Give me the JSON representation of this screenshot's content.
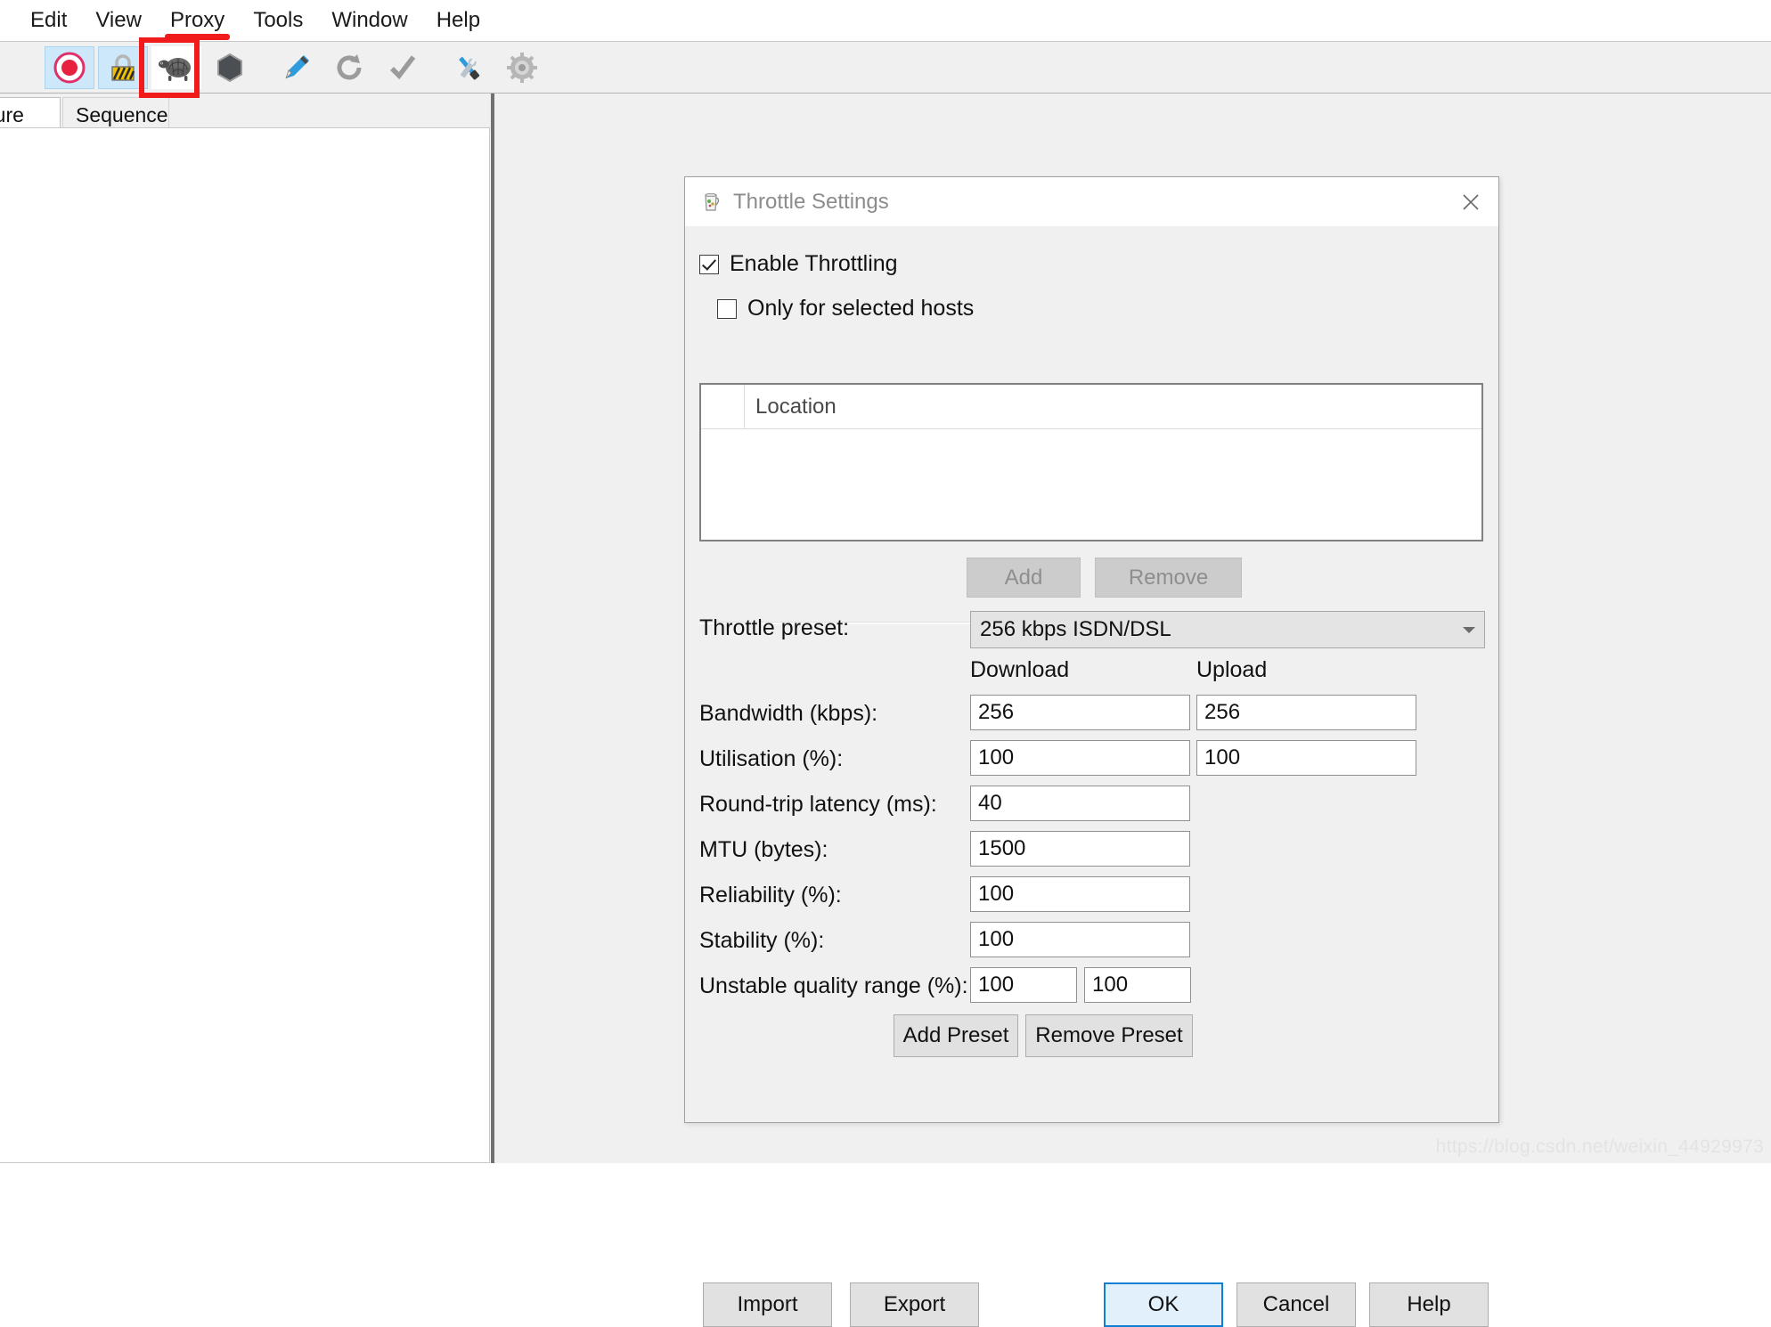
{
  "menubar": {
    "items": [
      {
        "label": "Edit",
        "underlined": false
      },
      {
        "label": "View",
        "underlined": false
      },
      {
        "label": "Proxy",
        "underlined": true
      },
      {
        "label": "Tools",
        "underlined": false
      },
      {
        "label": "Window",
        "underlined": false
      },
      {
        "label": "Help",
        "underlined": false
      }
    ]
  },
  "toolbar": {
    "icons": [
      {
        "name": "drag-handle-icon",
        "selected": false
      },
      {
        "name": "record-icon",
        "selected": true
      },
      {
        "name": "ssl-proxying-icon",
        "selected": true
      },
      {
        "name": "throttle-turtle-icon",
        "selected": false,
        "highlighted": true
      },
      {
        "name": "breakpoints-hexagon-icon",
        "selected": false
      },
      {
        "name": "compose-pen-icon",
        "selected": false
      },
      {
        "name": "repeat-refresh-icon",
        "selected": false
      },
      {
        "name": "validate-check-icon",
        "selected": false
      },
      {
        "name": "tools-icon",
        "selected": false
      },
      {
        "name": "settings-gear-icon",
        "selected": false
      }
    ]
  },
  "tabs": [
    {
      "label": "ucture",
      "active": true
    },
    {
      "label": "Sequence",
      "active": false
    }
  ],
  "dialog": {
    "title": "Throttle Settings",
    "icon": "charles-jug-icon",
    "close_label": "×",
    "enable_throttling": {
      "label": "Enable Throttling",
      "checked": true
    },
    "only_selected_hosts": {
      "label": "Only for selected hosts",
      "checked": false
    },
    "location_table": {
      "columns": [
        "",
        "Location"
      ],
      "rows": []
    },
    "add_label": "Add",
    "remove_label": "Remove",
    "add_enabled": false,
    "remove_enabled": false,
    "preset": {
      "label": "Throttle preset:",
      "value": "256 kbps ISDN/DSL"
    },
    "column_headers": {
      "download": "Download",
      "upload": "Upload"
    },
    "fields": [
      {
        "label": "Bandwidth (kbps):",
        "download": "256",
        "upload": "256"
      },
      {
        "label": "Utilisation (%):",
        "download": "100",
        "upload": "100"
      },
      {
        "label": "Round-trip latency (ms):",
        "download": "40",
        "upload": null
      },
      {
        "label": "MTU (bytes):",
        "download": "1500",
        "upload": null
      },
      {
        "label": "Reliability (%):",
        "download": "100",
        "upload": null
      },
      {
        "label": "Stability (%):",
        "download": "100",
        "upload": null
      },
      {
        "label": "Unstable quality range (%):",
        "download": "100",
        "upload": "100"
      }
    ],
    "add_preset_label": "Add Preset",
    "remove_preset_label": "Remove Preset",
    "import_label": "Import",
    "export_label": "Export",
    "ok_label": "OK",
    "cancel_label": "Cancel",
    "help_label": "Help"
  },
  "watermark": "https://blog.csdn.net/weixin_44929973",
  "colors": {
    "accent_blue": "#0f7fd4",
    "highlight_red": "#f21b1b",
    "window_bg": "#f0f0f0",
    "dialog_title_text": "#8c8c8c"
  }
}
